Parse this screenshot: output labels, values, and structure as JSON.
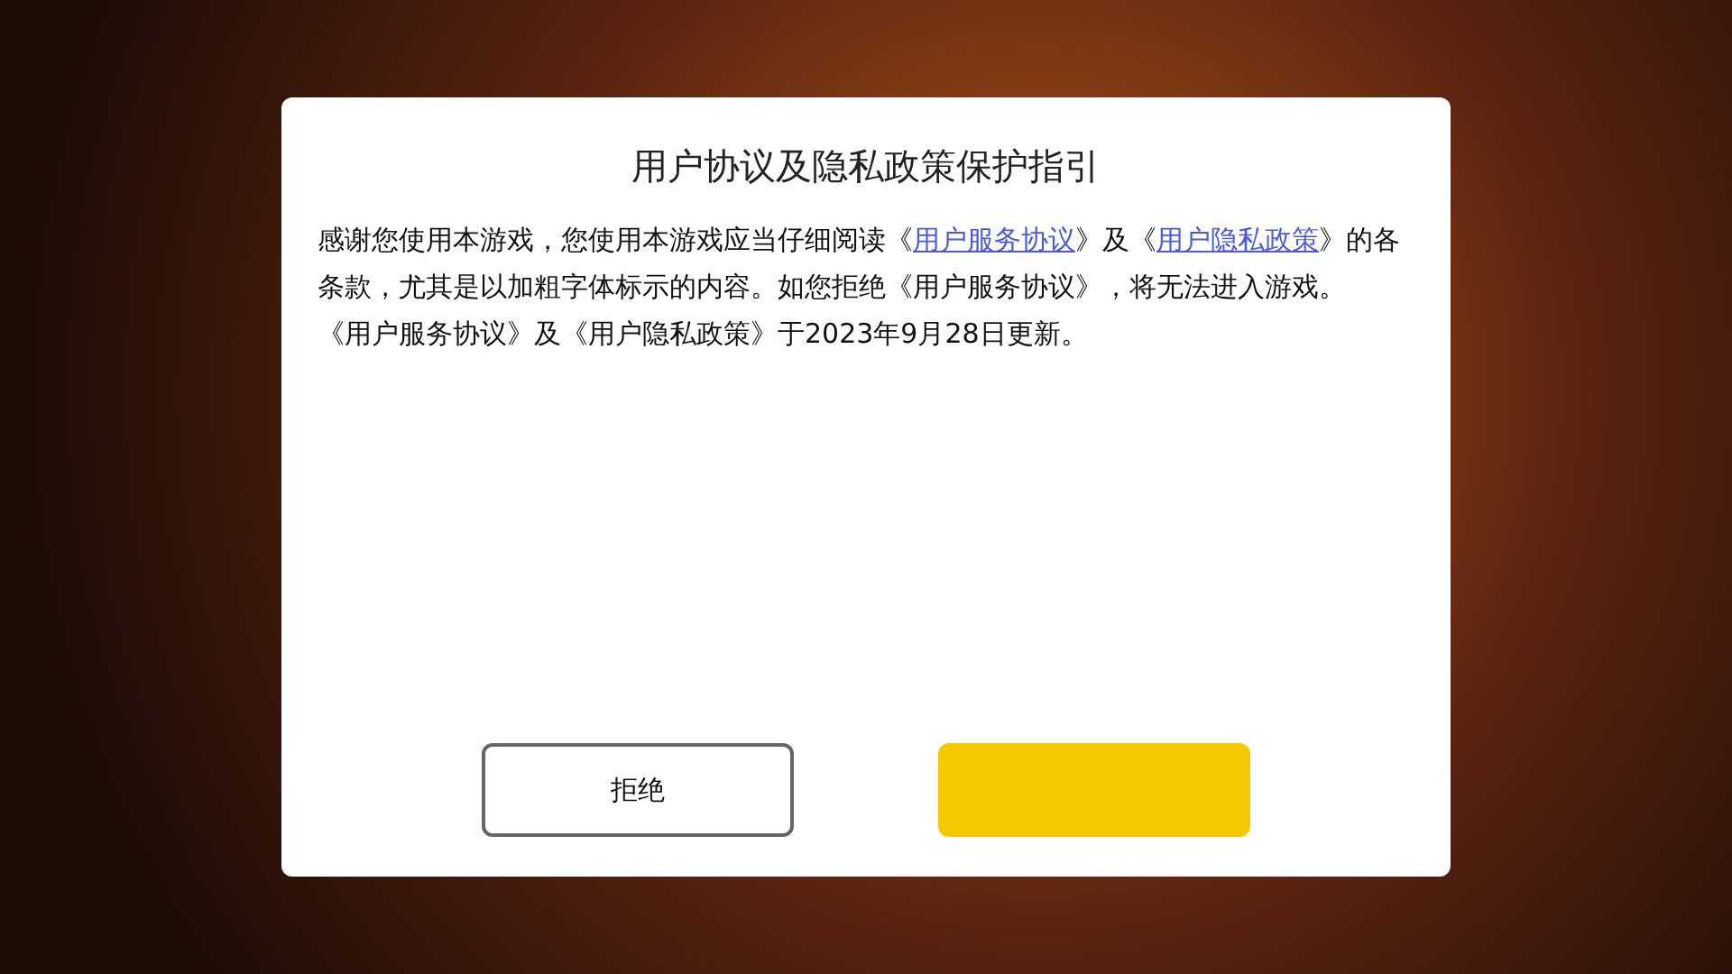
{
  "dialog": {
    "title": "用户协议及隐私政策保护指引",
    "paragraphs": [
      [
        {
          "kind": "text",
          "text": "感谢您使用本游戏，您使用本游戏应当仔细阅读《"
        },
        {
          "kind": "link",
          "text": "用户服务协议"
        },
        {
          "kind": "text",
          "text": "》及《"
        },
        {
          "kind": "link",
          "text": "用户隐私政策"
        },
        {
          "kind": "text",
          "text": "》的各条款，尤其是以加粗字体标示的内容。如您拒绝《用户服务协议》，将无法进入游戏。"
        }
      ],
      [
        {
          "kind": "text",
          "text": "《用户服务协议》及《用户隐私政策》于2023年9月28日更新。"
        }
      ]
    ],
    "buttons": [
      {
        "kind": "outline",
        "label": "拒绝"
      },
      {
        "kind": "primary"
      }
    ]
  }
}
